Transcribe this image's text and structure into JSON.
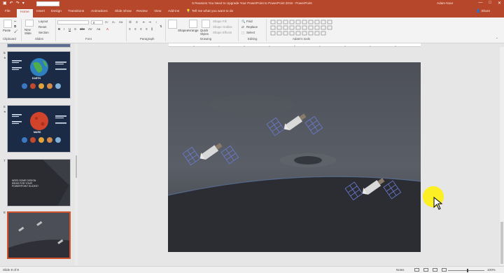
{
  "titlebar": {
    "doc_title": "5 Reasons You Need to Upgrade Your PowerPoint to PowerPoint 2016 - PowerPoint",
    "user": "Adam Noar",
    "minimize": "—",
    "restore": "□",
    "close": "✕"
  },
  "tabs": {
    "file": "File",
    "home": "Home",
    "insert": "Insert",
    "design": "Design",
    "transitions": "Transitions",
    "animations": "Animations",
    "slideshow": "Slide Show",
    "review": "Review",
    "view": "View",
    "addins": "Add-ins",
    "tell": "Tell me what you want to do",
    "share": "Share"
  },
  "ribbon": {
    "clipboard": {
      "label": "Clipboard",
      "paste": "Paste"
    },
    "slides": {
      "label": "Slides",
      "new_slide": "New Slide",
      "layout": "Layout",
      "reset": "Reset",
      "section": "Section"
    },
    "font": {
      "label": "Font",
      "size": "0"
    },
    "paragraph": {
      "label": "Paragraph"
    },
    "drawing": {
      "label": "Drawing",
      "shapes": "Shapes",
      "arrange": "Arrange",
      "quick_styles": "Quick Styles",
      "shape_fill": "Shape Fill",
      "shape_outline": "Shape Outline",
      "shape_effects": "Shape Effects"
    },
    "editing": {
      "label": "Editing",
      "find": "Find",
      "replace": "Replace",
      "select": "Select"
    },
    "adams_tools": {
      "label": "Adam's tools"
    }
  },
  "thumbnails": [
    {
      "num": "5",
      "star": "★",
      "title": "EARTH",
      "bg": "#1b2a45"
    },
    {
      "num": "6",
      "star": "★",
      "title": "MARS",
      "bg": "#1b2a45"
    },
    {
      "num": "7",
      "star": "",
      "caption": "NEED SOME DESIGN IDEAS FOR YOUR POWERPOINT SLIDES?",
      "bg": "#2a2c31"
    },
    {
      "num": "8",
      "star": "",
      "bg": "#4b4e56"
    }
  ],
  "status": {
    "slide_count": "Slide 8 of 8",
    "notes": "Notes",
    "zoom": "100%"
  },
  "colors": {
    "accent": "#b7472a",
    "selected_border": "#d35230",
    "cursor_highlight": "#fff000"
  }
}
